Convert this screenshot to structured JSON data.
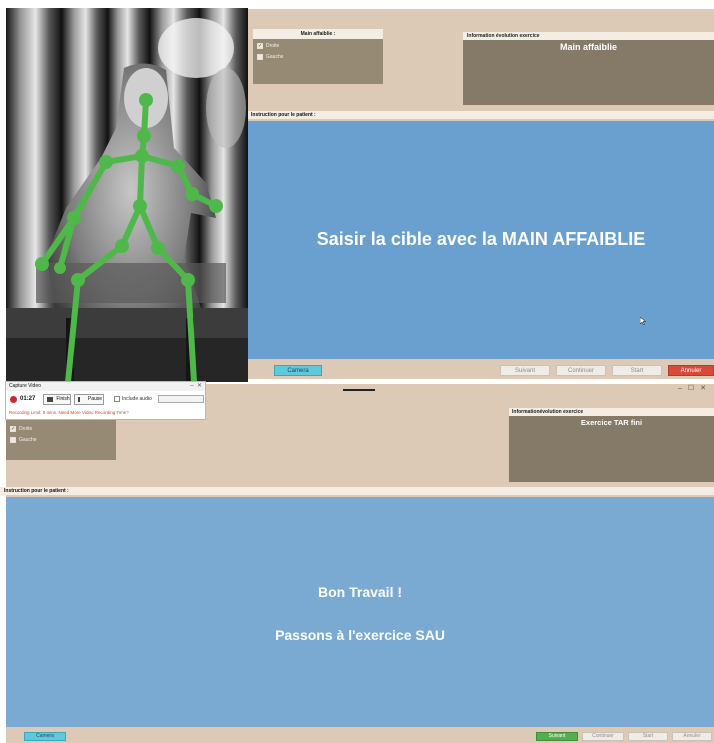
{
  "top_app": {
    "hand_panel": {
      "title": "Main affaiblie :",
      "options": [
        "Droite",
        "Gauche"
      ],
      "checked": "Droite"
    },
    "info_panel": {
      "title": "Information évolution exercice",
      "body": "Main affaiblie"
    },
    "instruction_label": "Instruction pour le patient :",
    "instruction_text": "Saisir la cible avec la MAIN AFFAIBLIE",
    "buttons": {
      "camera": "Camera",
      "suivant": "Suivant",
      "continuer": "Continuer",
      "start": "Start",
      "annuler": "Annuler"
    }
  },
  "capture_window": {
    "title": "Capture Video",
    "time": "01:27",
    "finish_label": "Finish",
    "pause_label": "Pause",
    "include_audio": "Include audio",
    "limit_text": "Recording Limit: 5 mins. Need More Video Recording Time?"
  },
  "bottom_app": {
    "hand_panel": {
      "options": [
        "Droite",
        "Gauche"
      ],
      "checked": "Droite"
    },
    "info_panel": {
      "title": "Informationévolution exercice",
      "body": "Exercice TAR fini"
    },
    "instruction_label": "Instruction pour le patient :",
    "instruction_line1": "Bon Travail !",
    "instruction_line2": "Passons à l'exercice SAU",
    "buttons": {
      "camera": "Camera",
      "suivant": "Suivant",
      "continuer": "Continuer",
      "start": "Start",
      "annuler": "Annuler"
    }
  },
  "colors": {
    "beige": "#ddcab6",
    "panel_brown": "#978a75",
    "info_brown": "#857a67",
    "instruction_blue": "#6aa0cf",
    "camera_cyan": "#5ec8dc",
    "annuler_red": "#d94a3a",
    "suivant_green": "#56ad4d",
    "skeleton_green": "#4fb84a"
  },
  "window_controls": [
    "–",
    "☐",
    "✕"
  ]
}
